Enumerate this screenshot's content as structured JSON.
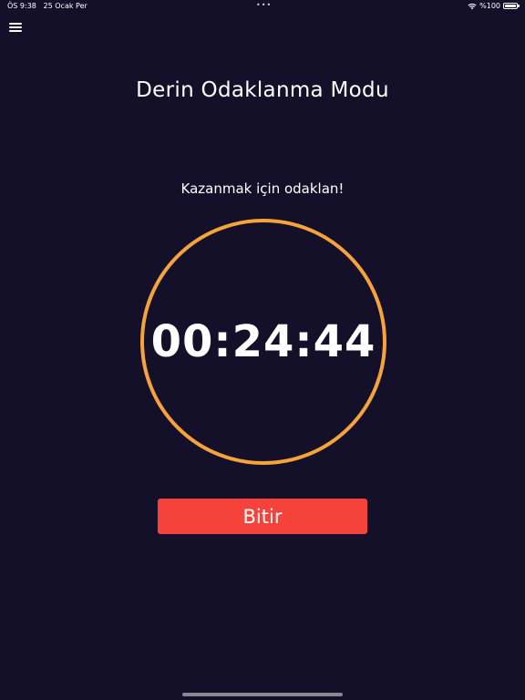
{
  "status_bar": {
    "time": "ÖS 9:38",
    "date": "25 Ocak Per",
    "multitask_dots": "•••",
    "battery_label": "%100",
    "icons": [
      "wifi-icon",
      "battery-icon"
    ]
  },
  "header": {
    "menu_icon": "hamburger-menu-icon"
  },
  "main": {
    "title": "Derin Odaklanma Modu",
    "subtitle": "Kazanmak için odaklan!",
    "timer": "00:24:44",
    "finish_button_label": "Bitir"
  },
  "colors": {
    "background": "#14102a",
    "ring": "#f5a33a",
    "button": "#f5433b",
    "text": "#ffffff"
  }
}
